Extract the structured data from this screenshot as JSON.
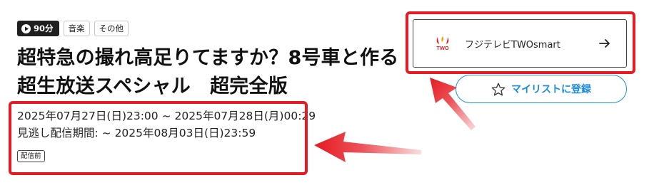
{
  "tags": {
    "duration": "90分",
    "genres": [
      "音楽",
      "その他"
    ]
  },
  "program": {
    "title": "超特急の撮れ高足りてますか？8号車と作る超生放送スペシャル　超完全版",
    "broadcast_time": "2025年07月27日(日)23:00 ~ 2025年07月28日(月)00:29",
    "catchup_period": "見逃し配信期間: ~ 2025年08月03日(日)23:59",
    "status": "配信前"
  },
  "channel": {
    "name": "フジテレビTWOsmart",
    "logo_text": "TWO"
  },
  "mylist": {
    "label": "マイリストに登録"
  },
  "colors": {
    "highlight": "#e51a22",
    "accent": "#1e8ee0",
    "tag_dark": "#1f1f1f"
  },
  "icons": [
    "play-icon",
    "channel-logo-icon",
    "arrow-right-icon",
    "star-outline-icon"
  ]
}
